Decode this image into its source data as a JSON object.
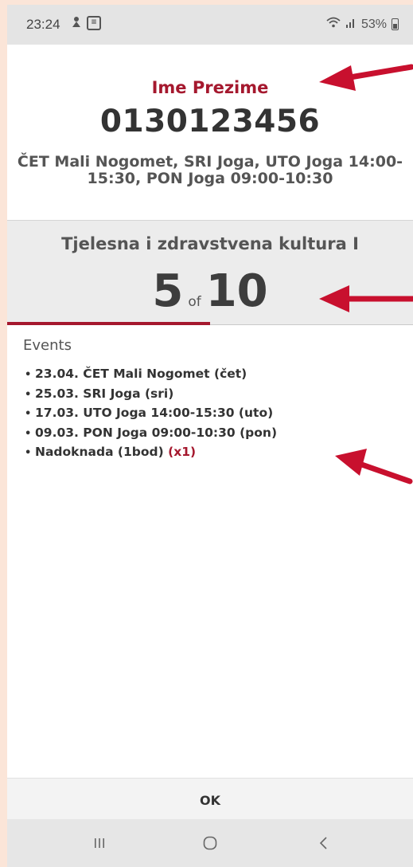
{
  "status_bar": {
    "time": "23:24",
    "battery_percent": "53%",
    "left_icons": [
      "notification-icon",
      "message-icon"
    ],
    "right_icons": [
      "wifi-icon",
      "signal-icon",
      "battery-icon"
    ]
  },
  "student": {
    "name": "Ime Prezime",
    "id": "0130123456",
    "schedule": "ČET Mali Nogomet, SRI Joga, UTO Joga 14:00-15:30, PON Joga 09:00-10:30"
  },
  "course": {
    "title": "Tjelesna i zdravstvena kultura I",
    "current": "5",
    "of_label": "of",
    "total": "10",
    "progress_fraction": 0.5
  },
  "events": {
    "title": "Events",
    "items": [
      {
        "text": "23.04. ČET Mali Nogomet (čet)",
        "suffix": ""
      },
      {
        "text": "25.03. SRI Joga (sri)",
        "suffix": ""
      },
      {
        "text": "17.03. UTO Joga 14:00-15:30 (uto)",
        "suffix": ""
      },
      {
        "text": "09.03. PON Joga 09:00-10:30 (pon)",
        "suffix": ""
      },
      {
        "text": "Nadoknada (1bod) ",
        "suffix": "(x1)"
      }
    ]
  },
  "actions": {
    "ok_label": "OK"
  },
  "navigation": {
    "buttons": [
      "recent-apps-icon",
      "home-icon",
      "back-icon"
    ]
  },
  "colors": {
    "accent": "#a5182e",
    "annotation_arrow": "#c8102e",
    "page_background": "#fbe5d8"
  }
}
